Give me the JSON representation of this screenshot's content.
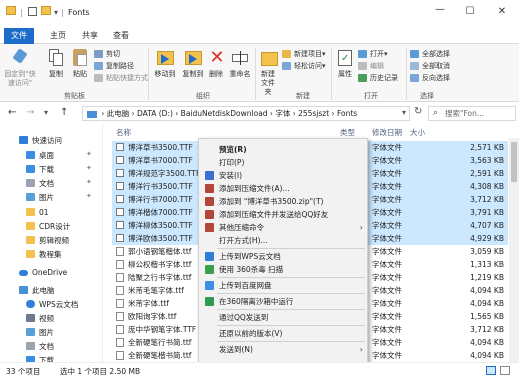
{
  "window": {
    "title": "Fonts",
    "title_sep": "|",
    "qa_dropdown": "▾"
  },
  "tabs": [
    "文件",
    "主页",
    "共享",
    "查看"
  ],
  "ribbon": {
    "pin_label": "固定到\"快速访问\"",
    "copy_label": "复制",
    "paste_label": "粘贴",
    "cut_label": "剪切",
    "copy_path_label": "复制路径",
    "paste_shortcut_label": "粘贴快捷方式",
    "move_to_label": "移动到",
    "copy_to_label": "复制到",
    "delete_label": "删除",
    "rename_label": "重命名",
    "new_folder_label": "新建文件夹",
    "new_item_label": "新建项目▾",
    "easy_access_label": "轻松访问▾",
    "properties_label": "属性",
    "open_label": "打开▾",
    "edit_label": "编辑",
    "history_label": "历史记录",
    "select_all_label": "全部选择",
    "select_none_label": "全部取消",
    "invert_label": "反向选择",
    "groups": {
      "clipboard": "剪贴板",
      "organize": "组织",
      "new": "新建",
      "open": "打开",
      "select": "选择"
    }
  },
  "address": {
    "back": "←",
    "forward": "→",
    "down": "▾",
    "up": "↑",
    "path": "›  此电脑  ›  DATA (D:)  ›  BaiduNetdiskDownload  ›  字体  ›  255sjszt  ›  Fonts",
    "dropdown": "▾",
    "refresh": "↻",
    "search_placeholder": "搜索\"Fon...",
    "search_icon": "⌕"
  },
  "nav": {
    "quick_access": "快速访问",
    "items": [
      "桌面",
      "下载",
      "文档",
      "图片",
      "01",
      "CDR设计",
      "剪辑视频",
      "教程集"
    ],
    "onedrive": "OneDrive",
    "this_pc": "此电脑",
    "pc_items": [
      "WPS云文档",
      "视频",
      "图片",
      "文档",
      "下载"
    ]
  },
  "columns": {
    "name": "名称",
    "date": "修改日期",
    "type": "类型",
    "size": "大小"
  },
  "files": [
    {
      "name": "博洋草书3500.TTF",
      "size": "2,571 KB",
      "selected": true
    },
    {
      "name": "博洋草书7000.TTF",
      "size": "3,563 KB",
      "selected": true
    },
    {
      "name": "博洋规范字3500.TTF",
      "size": "2,591 KB",
      "selected": true
    },
    {
      "name": "博洋行书3500.TTF",
      "size": "4,308 KB",
      "selected": true
    },
    {
      "name": "博洋行书7000.TTF",
      "size": "3,712 KB",
      "selected": true
    },
    {
      "name": "博洋楷体7000.TTF",
      "size": "3,791 KB",
      "selected": true
    },
    {
      "name": "博洋柳体3500.TTF",
      "size": "4,707 KB",
      "selected": true
    },
    {
      "name": "博洋欧体3500.TTF",
      "size": "4,929 KB",
      "selected": true
    },
    {
      "name": "郭小语钢笔楷体.ttf",
      "size": "3,059 KB",
      "selected": false
    },
    {
      "name": "柳公权楷书字体.ttf",
      "size": "1,313 KB",
      "selected": false
    },
    {
      "name": "陆聚之行书字体.ttf",
      "size": "1,219 KB",
      "selected": false
    },
    {
      "name": "米芾毛笔字体.ttf",
      "size": "4,094 KB",
      "selected": false
    },
    {
      "name": "米芾字体.ttf",
      "size": "4,094 KB",
      "selected": false
    },
    {
      "name": "欧阳询字体.ttf",
      "size": "1,565 KB",
      "selected": false
    },
    {
      "name": "庞中华钢笔字体.TTF",
      "size": "3,712 KB",
      "selected": false
    },
    {
      "name": "全新硬笔行书简.ttf",
      "size": "4,094 KB",
      "selected": false
    },
    {
      "name": "全新硬笔楷书简.ttf",
      "size": "4,094 KB",
      "selected": false
    }
  ],
  "file_type": "字体文件",
  "context_menu": [
    {
      "label": "预览(R)",
      "bold": true,
      "icon": "none"
    },
    {
      "label": "打印(P)",
      "icon": "none"
    },
    {
      "label": "安装(I)",
      "icon": "shield-icon"
    },
    {
      "label": "添加到压缩文件(A)...",
      "icon": "archive-icon"
    },
    {
      "label": "添加到 \"博洋草书3500.zip\"(T)",
      "icon": "archive-icon"
    },
    {
      "label": "添加到压缩文件并发送给QQ好友",
      "icon": "archive-icon"
    },
    {
      "label": "其他压缩命令",
      "icon": "archive-icon",
      "sub": true
    },
    {
      "label": "打开方式(H)...",
      "icon": "none"
    },
    {
      "label": "上传到WPS云文档",
      "icon": "cloud-upload-icon",
      "sep_before": true
    },
    {
      "label": "使用 360杀毒 扫描",
      "icon": "antivirus-icon"
    },
    {
      "label": "上传到百度网盘",
      "icon": "baidu-icon",
      "sep_before": true
    },
    {
      "label": "在360隔离沙箱中运行",
      "icon": "sandbox-icon",
      "sep_before": true
    },
    {
      "label": "通过QQ发送到",
      "icon": "none",
      "sep_before": true
    },
    {
      "label": "还原以前的版本(V)",
      "icon": "none",
      "sep_before": true
    },
    {
      "label": "发送到(N)",
      "icon": "none",
      "sub": true,
      "sep_before": true
    }
  ],
  "submenu_arrow": "›",
  "status": {
    "count": "33 个项目",
    "selected": "选中 1 个项目  2.50 MB"
  },
  "colors": {
    "accent": "#1e6cc9",
    "selected_row": "#cce8ff",
    "folder": "#f2c14e"
  }
}
